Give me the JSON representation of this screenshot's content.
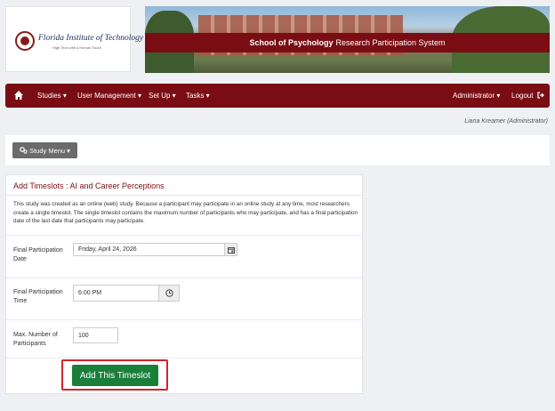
{
  "logo": {
    "name": "Florida Institute of Technology",
    "tagline": "High Tech with a Human Touch"
  },
  "banner": {
    "title_bold": "School of Psychology",
    "title_rest": "Research Participation System"
  },
  "nav": {
    "home_icon": "home-icon",
    "studies": "Studies ▾",
    "user_management": "User Management ▾",
    "setup": "Set Up ▾",
    "tasks": "Tasks ▾",
    "administrator": "Administrator ▾",
    "logout": "Logout"
  },
  "user_line": "Liana Kreamer (Administrator)",
  "study_menu": {
    "label": "Study Menu ▾",
    "icon": "gears-icon"
  },
  "card": {
    "title": "Add Timeslots : AI and Career Perceptions",
    "description": "This study was created as an online (web) study. Because a participant may participate in an online study at any time, most researchers create a single timeslot. The single timeslot contains the maximum number of participants who may participate, and has a final participation date of the last date that participants may participate.",
    "final_date_label": "Final Participation Date",
    "final_date_value": "Friday, April 24, 2026",
    "final_time_label": "Final Participation Time",
    "final_time_value": "6:00 PM",
    "max_label": "Max. Number of Participants",
    "max_value": "100",
    "add_button": "Add This Timeslot"
  },
  "colors": {
    "maroon": "#7a0d14",
    "green": "#1a7f3a",
    "highlight": "#d2232a"
  }
}
